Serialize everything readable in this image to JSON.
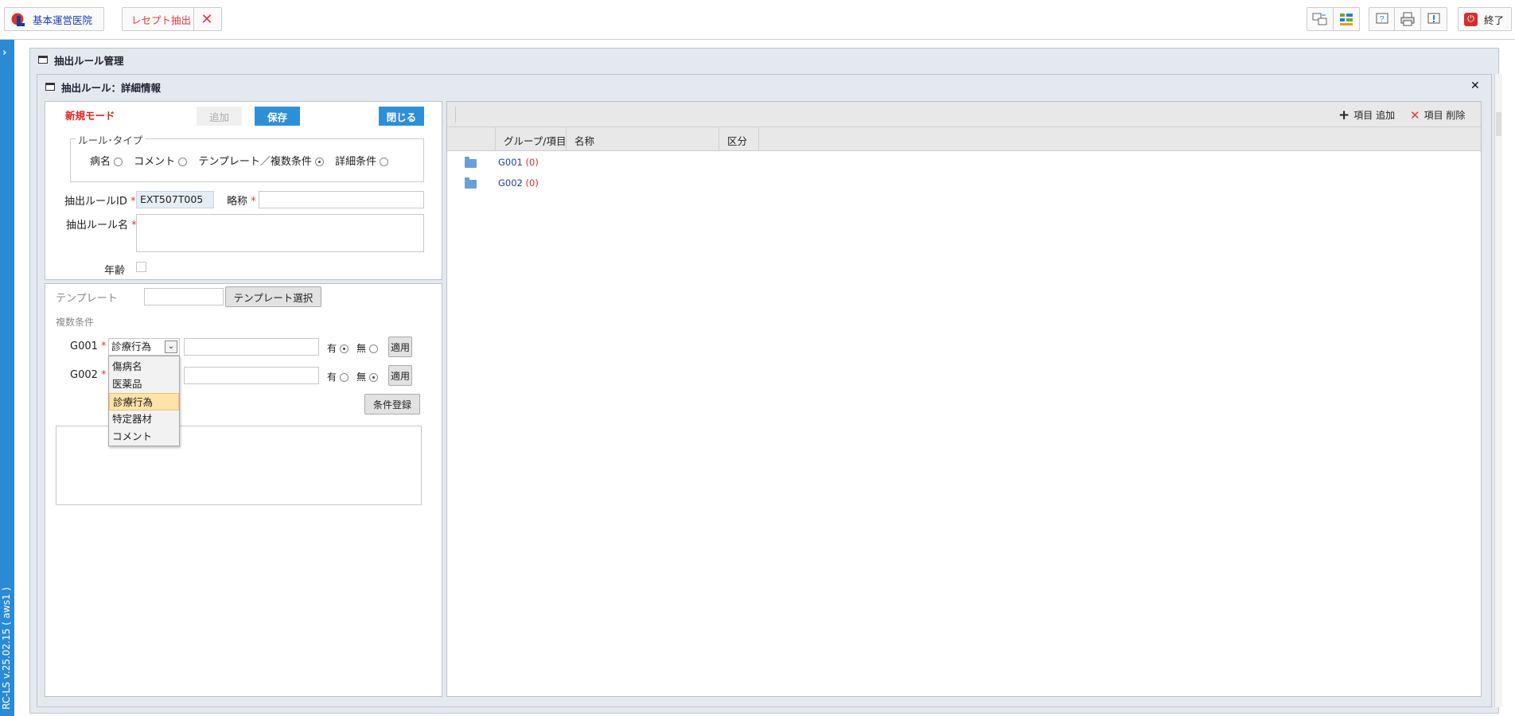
{
  "topbar": {
    "hospital_label": "基本運営医院",
    "module_label": "レセプト抽出",
    "exit_label": "終了"
  },
  "sidebar": {
    "version": "RC-LS v.25.02.15 ( aws1 )"
  },
  "outer_panel": {
    "title": "抽出ルール管理"
  },
  "inner_panel": {
    "title": "抽出ルール：詳細情報"
  },
  "form": {
    "mode": "新規モード",
    "add_label": "追加",
    "save_label": "保存",
    "close_label": "閉じる",
    "rule_type_legend": "ルール･タイプ",
    "rule_types": [
      {
        "label": "病名",
        "selected": false
      },
      {
        "label": "コメント",
        "selected": false
      },
      {
        "label": "テンプレート／複数条件",
        "selected": true
      },
      {
        "label": "詳細条件",
        "selected": false
      }
    ],
    "rule_id_label": "抽出ルールID",
    "rule_id_value": "EXT507T005",
    "short_name_label": "略称",
    "rule_name_label": "抽出ルール名",
    "age_label": "年齢"
  },
  "condition": {
    "template_label": "テンプレート",
    "template_select_label": "テンプレート選択",
    "multi_label": "複数条件",
    "rows": [
      {
        "name": "G001",
        "select_value": "診療行為",
        "yes_label": "有",
        "no_label": "無",
        "selected": "有",
        "apply_label": "適用"
      },
      {
        "name": "G002",
        "select_value": "",
        "yes_label": "有",
        "no_label": "無",
        "selected": "無",
        "apply_label": "適用"
      }
    ],
    "dropdown_options": [
      "傷病名",
      "医薬品",
      "診療行為",
      "特定器材",
      "コメント"
    ],
    "dropdown_highlighted": "診療行為",
    "register_label": "条件登録"
  },
  "tree": {
    "add_item_label": "項目 追加",
    "delete_item_label": "項目 削除",
    "columns": [
      "グループ/項目",
      "名称",
      "区分"
    ],
    "rows": [
      {
        "code": "G001",
        "count": "(0)"
      },
      {
        "code": "G002",
        "count": "(0)"
      }
    ]
  },
  "colors": {
    "accent": "#2e8fd9",
    "mode_red": "#e02020",
    "link_blue": "#1a3fb0"
  }
}
